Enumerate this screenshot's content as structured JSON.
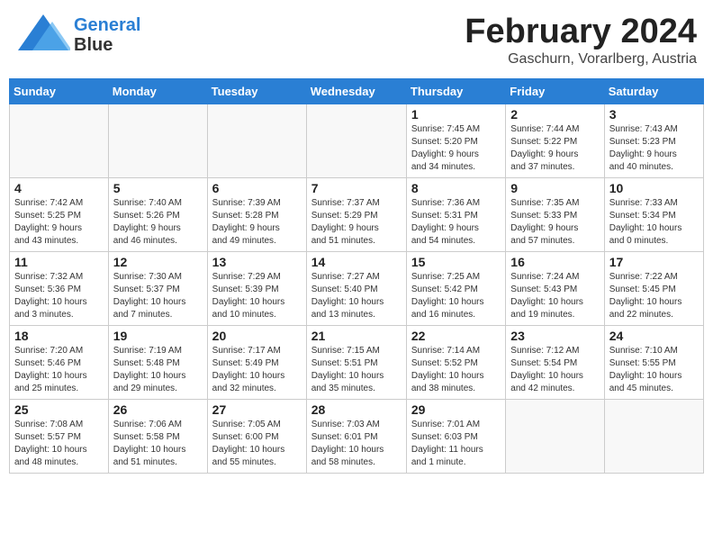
{
  "header": {
    "logo_line1": "General",
    "logo_line2": "Blue",
    "main_title": "February 2024",
    "subtitle": "Gaschurn, Vorarlberg, Austria"
  },
  "days_of_week": [
    "Sunday",
    "Monday",
    "Tuesday",
    "Wednesday",
    "Thursday",
    "Friday",
    "Saturday"
  ],
  "weeks": [
    [
      {
        "day": "",
        "info": ""
      },
      {
        "day": "",
        "info": ""
      },
      {
        "day": "",
        "info": ""
      },
      {
        "day": "",
        "info": ""
      },
      {
        "day": "1",
        "info": "Sunrise: 7:45 AM\nSunset: 5:20 PM\nDaylight: 9 hours\nand 34 minutes."
      },
      {
        "day": "2",
        "info": "Sunrise: 7:44 AM\nSunset: 5:22 PM\nDaylight: 9 hours\nand 37 minutes."
      },
      {
        "day": "3",
        "info": "Sunrise: 7:43 AM\nSunset: 5:23 PM\nDaylight: 9 hours\nand 40 minutes."
      }
    ],
    [
      {
        "day": "4",
        "info": "Sunrise: 7:42 AM\nSunset: 5:25 PM\nDaylight: 9 hours\nand 43 minutes."
      },
      {
        "day": "5",
        "info": "Sunrise: 7:40 AM\nSunset: 5:26 PM\nDaylight: 9 hours\nand 46 minutes."
      },
      {
        "day": "6",
        "info": "Sunrise: 7:39 AM\nSunset: 5:28 PM\nDaylight: 9 hours\nand 49 minutes."
      },
      {
        "day": "7",
        "info": "Sunrise: 7:37 AM\nSunset: 5:29 PM\nDaylight: 9 hours\nand 51 minutes."
      },
      {
        "day": "8",
        "info": "Sunrise: 7:36 AM\nSunset: 5:31 PM\nDaylight: 9 hours\nand 54 minutes."
      },
      {
        "day": "9",
        "info": "Sunrise: 7:35 AM\nSunset: 5:33 PM\nDaylight: 9 hours\nand 57 minutes."
      },
      {
        "day": "10",
        "info": "Sunrise: 7:33 AM\nSunset: 5:34 PM\nDaylight: 10 hours\nand 0 minutes."
      }
    ],
    [
      {
        "day": "11",
        "info": "Sunrise: 7:32 AM\nSunset: 5:36 PM\nDaylight: 10 hours\nand 3 minutes."
      },
      {
        "day": "12",
        "info": "Sunrise: 7:30 AM\nSunset: 5:37 PM\nDaylight: 10 hours\nand 7 minutes."
      },
      {
        "day": "13",
        "info": "Sunrise: 7:29 AM\nSunset: 5:39 PM\nDaylight: 10 hours\nand 10 minutes."
      },
      {
        "day": "14",
        "info": "Sunrise: 7:27 AM\nSunset: 5:40 PM\nDaylight: 10 hours\nand 13 minutes."
      },
      {
        "day": "15",
        "info": "Sunrise: 7:25 AM\nSunset: 5:42 PM\nDaylight: 10 hours\nand 16 minutes."
      },
      {
        "day": "16",
        "info": "Sunrise: 7:24 AM\nSunset: 5:43 PM\nDaylight: 10 hours\nand 19 minutes."
      },
      {
        "day": "17",
        "info": "Sunrise: 7:22 AM\nSunset: 5:45 PM\nDaylight: 10 hours\nand 22 minutes."
      }
    ],
    [
      {
        "day": "18",
        "info": "Sunrise: 7:20 AM\nSunset: 5:46 PM\nDaylight: 10 hours\nand 25 minutes."
      },
      {
        "day": "19",
        "info": "Sunrise: 7:19 AM\nSunset: 5:48 PM\nDaylight: 10 hours\nand 29 minutes."
      },
      {
        "day": "20",
        "info": "Sunrise: 7:17 AM\nSunset: 5:49 PM\nDaylight: 10 hours\nand 32 minutes."
      },
      {
        "day": "21",
        "info": "Sunrise: 7:15 AM\nSunset: 5:51 PM\nDaylight: 10 hours\nand 35 minutes."
      },
      {
        "day": "22",
        "info": "Sunrise: 7:14 AM\nSunset: 5:52 PM\nDaylight: 10 hours\nand 38 minutes."
      },
      {
        "day": "23",
        "info": "Sunrise: 7:12 AM\nSunset: 5:54 PM\nDaylight: 10 hours\nand 42 minutes."
      },
      {
        "day": "24",
        "info": "Sunrise: 7:10 AM\nSunset: 5:55 PM\nDaylight: 10 hours\nand 45 minutes."
      }
    ],
    [
      {
        "day": "25",
        "info": "Sunrise: 7:08 AM\nSunset: 5:57 PM\nDaylight: 10 hours\nand 48 minutes."
      },
      {
        "day": "26",
        "info": "Sunrise: 7:06 AM\nSunset: 5:58 PM\nDaylight: 10 hours\nand 51 minutes."
      },
      {
        "day": "27",
        "info": "Sunrise: 7:05 AM\nSunset: 6:00 PM\nDaylight: 10 hours\nand 55 minutes."
      },
      {
        "day": "28",
        "info": "Sunrise: 7:03 AM\nSunset: 6:01 PM\nDaylight: 10 hours\nand 58 minutes."
      },
      {
        "day": "29",
        "info": "Sunrise: 7:01 AM\nSunset: 6:03 PM\nDaylight: 11 hours\nand 1 minute."
      },
      {
        "day": "",
        "info": ""
      },
      {
        "day": "",
        "info": ""
      }
    ]
  ]
}
